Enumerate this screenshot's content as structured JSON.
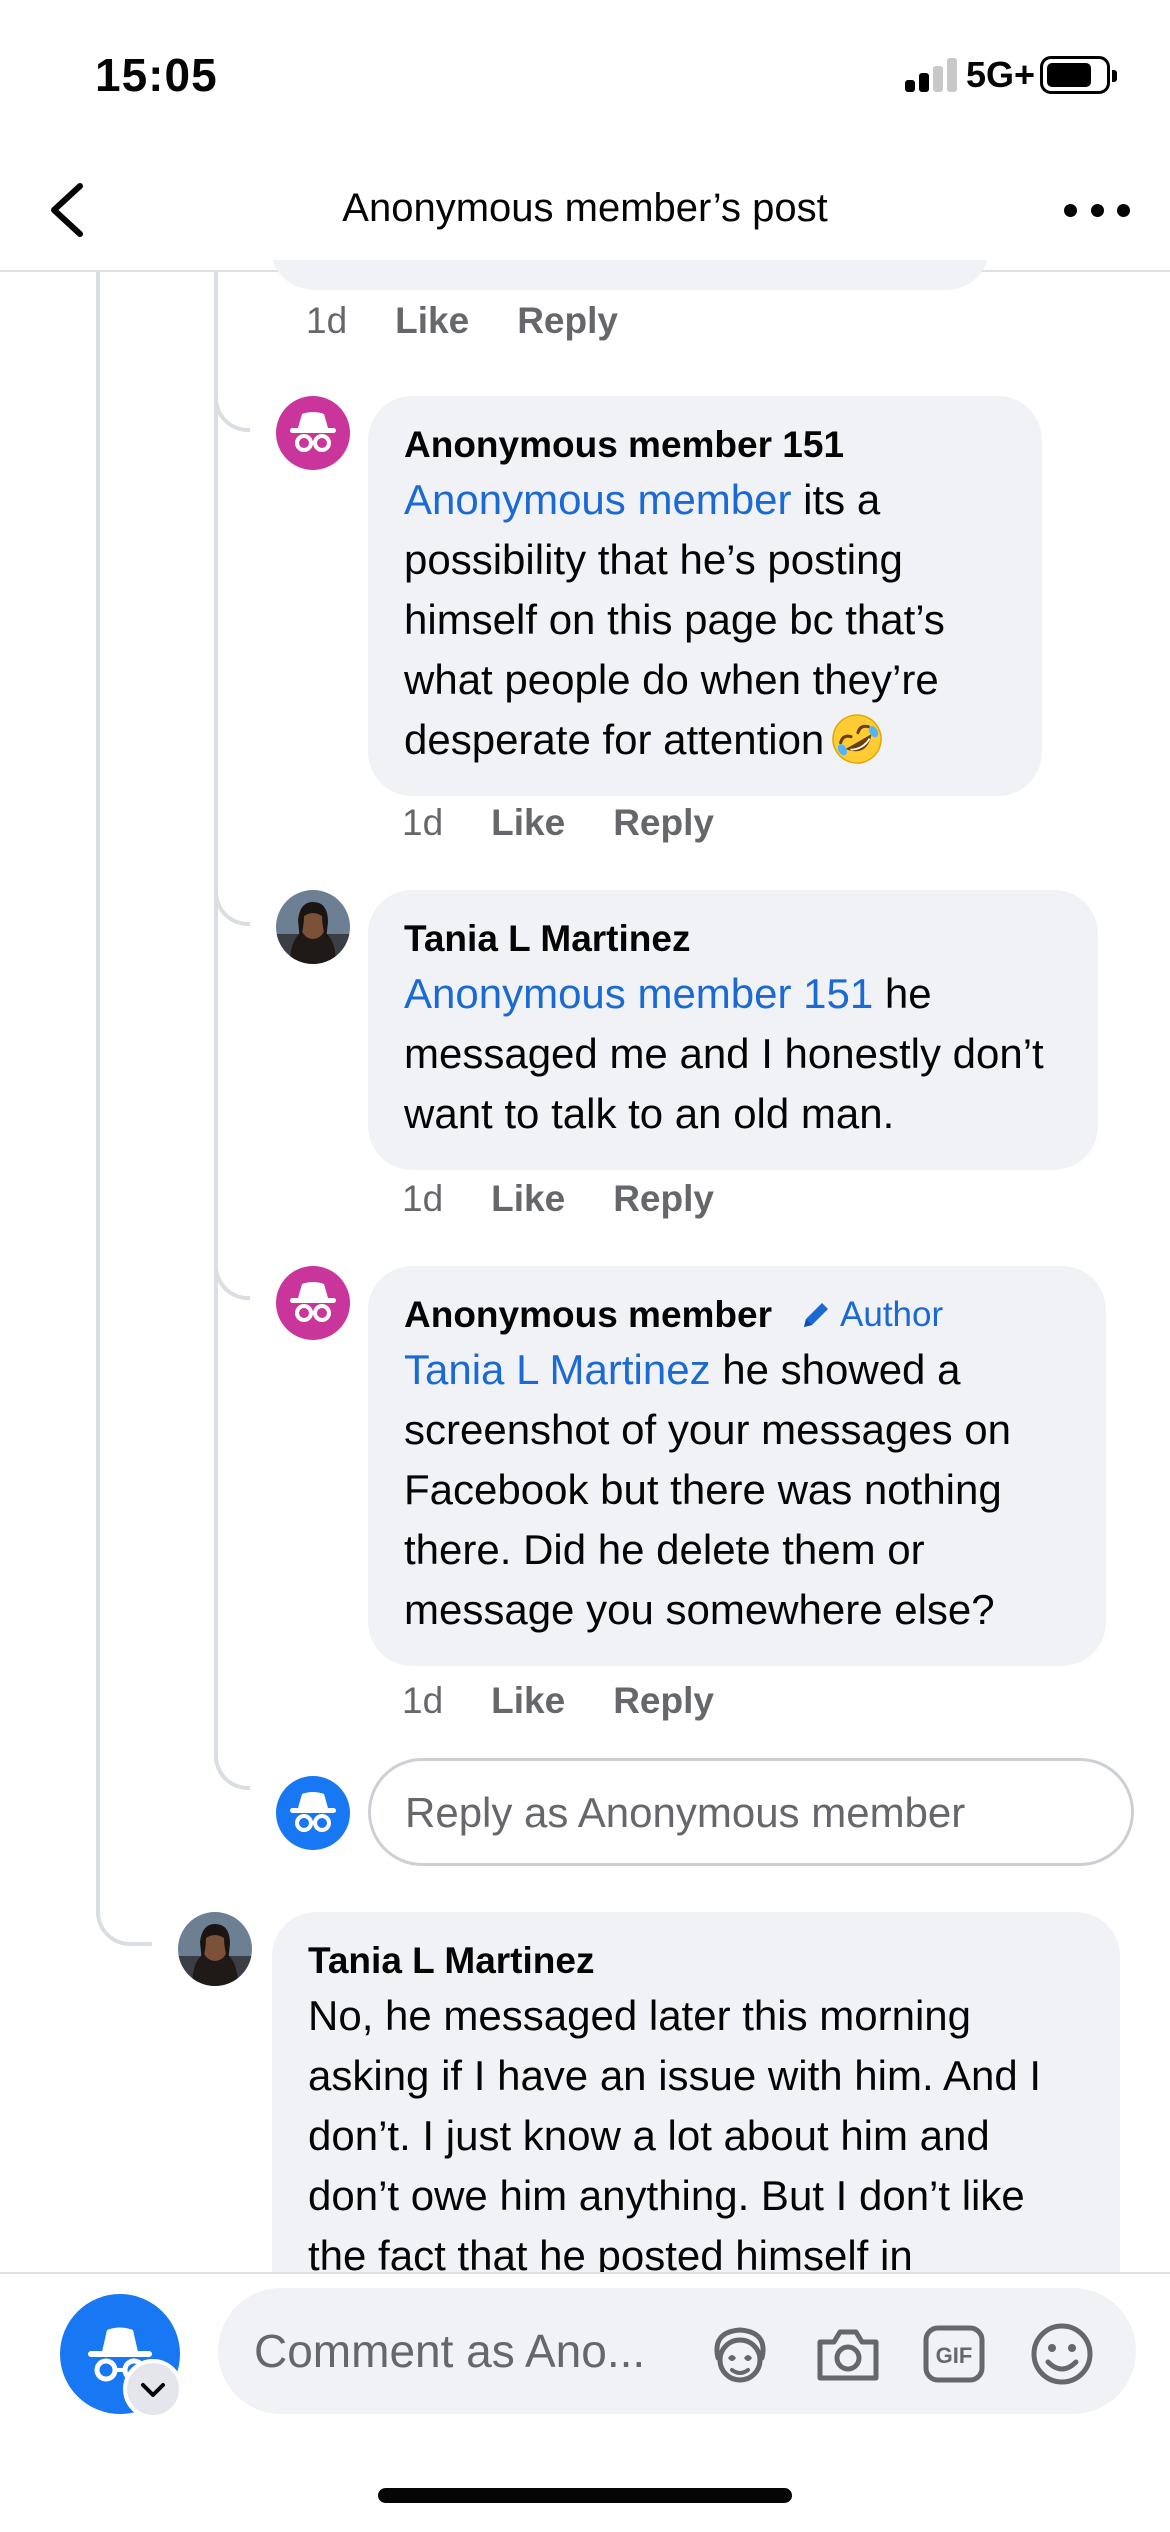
{
  "status_bar": {
    "time": "15:05",
    "network": "5G+"
  },
  "header": {
    "title": "Anonymous member’s post"
  },
  "prev_comment_actions": {
    "age": "1d",
    "like": "Like",
    "reply": "Reply"
  },
  "replies": [
    {
      "name": "Anonymous member 151",
      "mention": "Anonymous member",
      "text": " its a possibility that he’s posting himself on this page bc that’s what people do when they’re desperate for attention",
      "emoji": "rolling-on-floor-laughing",
      "age": "1d",
      "like": "Like",
      "reply": "Reply"
    },
    {
      "name": "Tania L Martinez",
      "mention": "Anonymous member 151",
      "text": " he messaged me and I honestly don’t want to talk to an old man.",
      "age": "1d",
      "like": "Like",
      "reply": "Reply"
    },
    {
      "name": "Anonymous member",
      "badge": "Author",
      "mention": "Tania L Martinez",
      "text": " he showed a screenshot of your messages on Facebook but there was nothing there. Did he delete them or message you somewhere else?",
      "age": "1d",
      "like": "Like",
      "reply": "Reply"
    }
  ],
  "reply_box": {
    "placeholder": "Reply as Anonymous member"
  },
  "top_comment": {
    "name": "Tania L Martinez",
    "text": "No, he messaged later this morning asking if I have an issue with him. And I don’t. I just know a lot about him and don’t owe him anything. But I don’t like the fact that he posted himself in"
  },
  "composer": {
    "placeholder": "Comment as Ano...",
    "icons": [
      "avatar-sticker-icon",
      "camera-icon",
      "gif-icon",
      "emoji-icon"
    ]
  },
  "colors": {
    "anon_pink": "#c9359b",
    "anon_blue": "#1877f2",
    "mention_blue": "#1a69d5",
    "bubble_gray": "#f0f2f5"
  }
}
